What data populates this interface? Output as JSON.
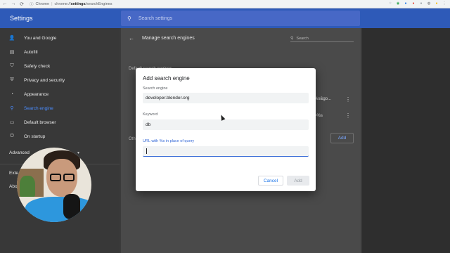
{
  "browser": {
    "back": "←",
    "forward": "→",
    "reload": "⟳",
    "page_icon": "ⓘ",
    "brand": "Chrome",
    "sep": "|",
    "url_prefix": "chrome://",
    "url_bold": "settings",
    "url_suffix": "/searchEngines",
    "extensions": [
      {
        "glyph": "☆",
        "color": "#9aa0a6"
      },
      {
        "glyph": "◉",
        "color": "#34a853"
      },
      {
        "glyph": "●",
        "color": "#1a73e8"
      },
      {
        "glyph": "●",
        "color": "#ea4335"
      },
      {
        "glyph": "●",
        "color": "#9aa0a6"
      },
      {
        "glyph": "◍",
        "color": "#5f6368"
      },
      {
        "glyph": "●",
        "color": "#fbbc04"
      },
      {
        "glyph": "⋮",
        "color": "#5f6368"
      }
    ]
  },
  "header": {
    "title": "Settings",
    "search_icon": "search-icon",
    "search_placeholder": "Search settings"
  },
  "sidebar": {
    "items": [
      {
        "label": "You and Google",
        "icon": "👤"
      },
      {
        "label": "Autofill",
        "icon": "▤"
      },
      {
        "label": "Safety check",
        "icon": "⛉"
      },
      {
        "label": "Privacy and security",
        "icon": "⛨"
      },
      {
        "label": "Appearance",
        "icon": "◔"
      },
      {
        "label": "Search engine",
        "icon": "⚲",
        "active": true
      },
      {
        "label": "Default browser",
        "icon": "▭"
      },
      {
        "label": "On startup",
        "icon": "⏻"
      }
    ],
    "advanced": "Advanced",
    "advanced_arrow": "▾",
    "extensions": "Exte",
    "about": "Abo"
  },
  "main": {
    "back_icon": "←",
    "title": "Manage search engines",
    "search_placeholder": "Search",
    "search_icon": "⚲",
    "section_default": "Default search engines",
    "row1_tail": "%s&go...",
    "row2_tail": "=%s",
    "more_icon": "⋮",
    "section_other": "Oth",
    "add_label": "Add"
  },
  "dialog": {
    "title": "Add search engine",
    "fields": [
      {
        "label": "Search engine",
        "value": "developer.blender.org"
      },
      {
        "label": "Keyword",
        "value": "db"
      },
      {
        "label": "URL with %s in place of query",
        "value": ""
      }
    ],
    "cancel_label": "Cancel",
    "add_label": "Add"
  },
  "colors": {
    "accent": "#3367d6",
    "header": "#2e5ab8",
    "sidebar_active": "#4a8cff"
  }
}
